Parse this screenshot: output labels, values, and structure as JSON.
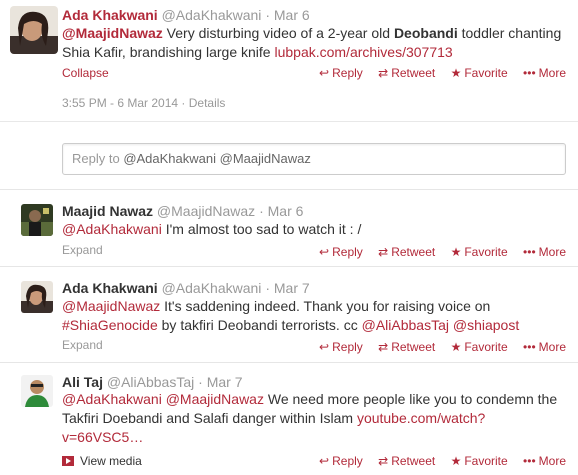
{
  "main_tweet": {
    "fullname": "Ada Khakwani",
    "username": "@AdaKhakwani",
    "dot": "·",
    "time": "Mar 6",
    "mention": "@MaajidNawaz",
    "text_1": " Very disturbing video of a 2-year old ",
    "bold": "Deobandi",
    "text_2": " toddler chanting Shia Kafir, brandishing large knife ",
    "link": "lubpak.com/archives/307713",
    "collapse_label": "Collapse",
    "reply_label": "Reply",
    "retweet_label": "Retweet",
    "favorite_label": "Favorite",
    "more_label": "More",
    "timestamp": "3:55 PM - 6 Mar 2014",
    "details_sep": "·",
    "details_label": "Details",
    "reply_prefix": "Reply to ",
    "reply_mentions": "@AdaKhakwani @MaajidNawaz"
  },
  "replies": [
    {
      "fullname": "Maajid Nawaz",
      "username": "@MaajidNawaz",
      "dot": "·",
      "time": "Mar 6",
      "mention": "@AdaKhakwani",
      "text": " I'm almost too sad to watch it : /",
      "expand_label": "Expand",
      "reply_label": "Reply",
      "retweet_label": "Retweet",
      "favorite_label": "Favorite",
      "more_label": "More"
    },
    {
      "fullname": "Ada Khakwani",
      "username": "@AdaKhakwani",
      "dot": "·",
      "time": "Mar 7",
      "mention": "@MaajidNawaz",
      "text_1": " It's saddening indeed. Thank you for raising voice on",
      "hashtag": "#ShiaGenocide",
      "text_2": "  by takfiri Deobandi terrorists. cc ",
      "mention_2": "@AliAbbasTaj",
      "mention_3": "@shiapost",
      "expand_label": "Expand",
      "reply_label": "Reply",
      "retweet_label": "Retweet",
      "favorite_label": "Favorite",
      "more_label": "More"
    },
    {
      "fullname": "Ali Taj",
      "username": "@AliAbbasTaj",
      "dot": "·",
      "time": "Mar 7",
      "mention": "@AdaKhakwani",
      "mention_2": "@MaajidNawaz",
      "text_1": " We need more people like you to condemn the Takfiri Doebandi and Salafi danger within Islam ",
      "link": "youtube.com/watch?v=66VSC5…",
      "view_media_label": "View media",
      "reply_label": "Reply",
      "retweet_label": "Retweet",
      "favorite_label": "Favorite",
      "more_label": "More"
    }
  ],
  "colors": {
    "link": "#b22a3a",
    "muted": "#999999",
    "text": "#333333"
  }
}
